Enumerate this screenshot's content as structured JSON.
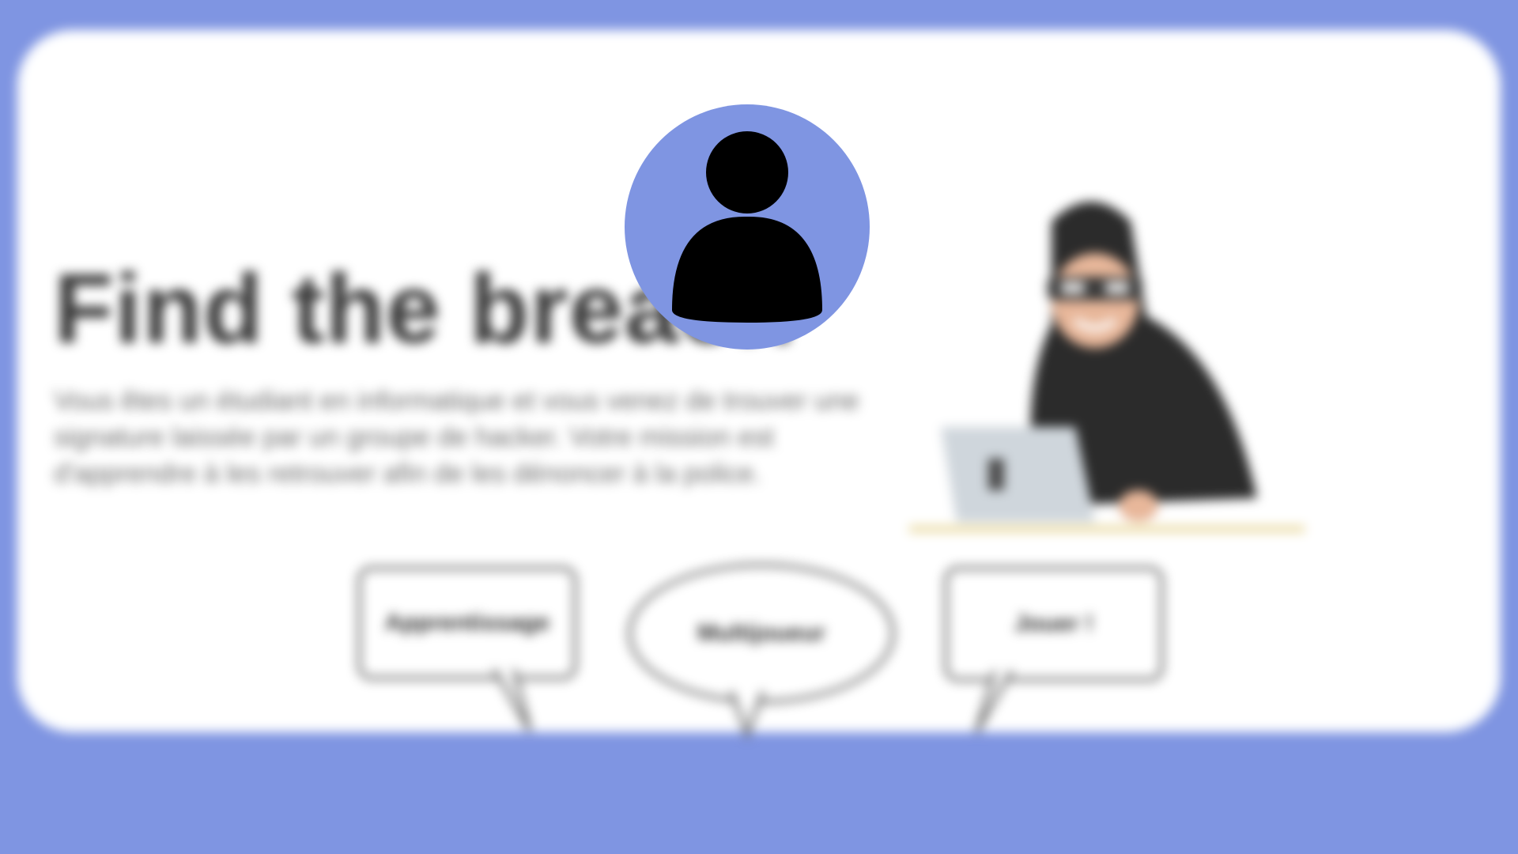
{
  "hero": {
    "title": "Find the breach",
    "description": "Vous êtes un étudiant en informatique et vous venez de trouver une signature laissée par un groupe de hacker. Votre mission est d'apprendre à les retrouver afin de les dénoncer à la police."
  },
  "modes": [
    {
      "label": "Apprentissage"
    },
    {
      "label": "Multijoueur"
    },
    {
      "label": "Jouer !"
    }
  ],
  "profile": {
    "icon": "user-avatar-icon"
  },
  "illustration": {
    "icon": "hacker-laptop-illustration"
  },
  "colors": {
    "background": "#7f95e2",
    "card": "#ffffff",
    "title": "#3a3a3a"
  }
}
